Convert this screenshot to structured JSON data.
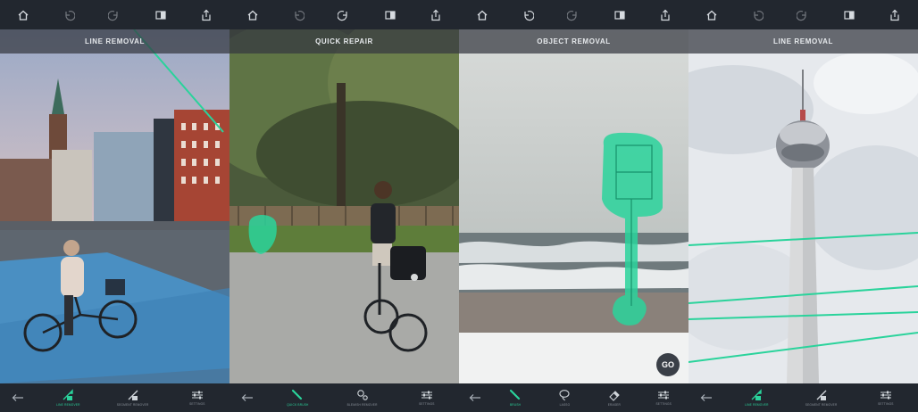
{
  "accent_color": "#2ad39b",
  "top_icons": [
    "home-icon",
    "undo-icon",
    "redo-icon",
    "compare-icon",
    "share-icon"
  ],
  "panels": [
    {
      "mode_title": "LINE REMOVAL",
      "tools": [
        {
          "label": "LINE REMOVER",
          "icon": "line-remover-icon",
          "active": true
        },
        {
          "label": "SEGMENT REMOVER",
          "icon": "segment-remover-icon",
          "active": false
        },
        {
          "label": "SETTINGS",
          "icon": "settings-icon",
          "active": false
        }
      ]
    },
    {
      "mode_title": "QUICK REPAIR",
      "tools": [
        {
          "label": "QUICK BRUSH",
          "icon": "quick-brush-icon",
          "active": true
        },
        {
          "label": "BLEMISH REMOVER",
          "icon": "blemish-remover-icon",
          "active": false
        },
        {
          "label": "SETTINGS",
          "icon": "settings-icon",
          "active": false
        }
      ]
    },
    {
      "mode_title": "OBJECT REMOVAL",
      "go_label": "GO",
      "tools": [
        {
          "label": "BRUSH",
          "icon": "brush-icon",
          "active": true
        },
        {
          "label": "LASSO",
          "icon": "lasso-icon",
          "active": false
        },
        {
          "label": "ERASER",
          "icon": "eraser-icon",
          "active": false
        },
        {
          "label": "SETTINGS",
          "icon": "settings-icon",
          "active": false
        }
      ]
    },
    {
      "mode_title": "LINE REMOVAL",
      "tools": [
        {
          "label": "LINE REMOVER",
          "icon": "line-remover-icon",
          "active": true
        },
        {
          "label": "SEGMENT REMOVER",
          "icon": "segment-remover-icon",
          "active": false
        },
        {
          "label": "SETTINGS",
          "icon": "settings-icon",
          "active": false
        }
      ]
    }
  ]
}
